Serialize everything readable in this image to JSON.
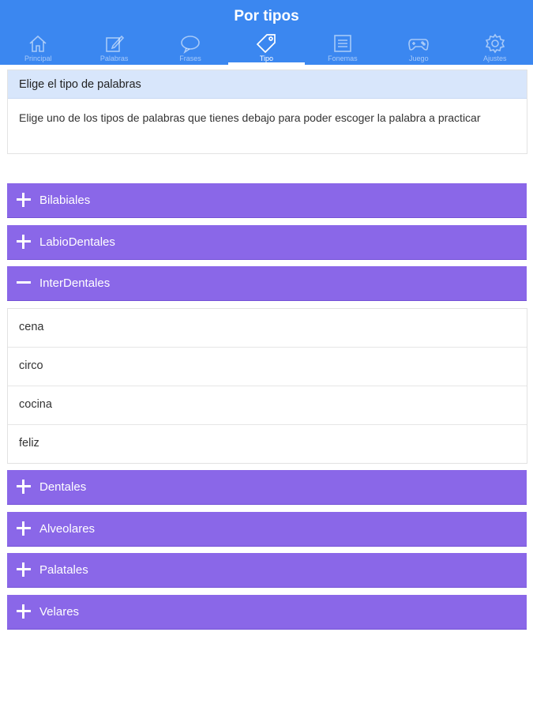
{
  "header": {
    "title": "Por tipos"
  },
  "tabs": [
    {
      "label": "Principal",
      "icon": "home-icon",
      "active": false
    },
    {
      "label": "Palabras",
      "icon": "edit-icon",
      "active": false
    },
    {
      "label": "Frases",
      "icon": "speech-bubble-icon",
      "active": false
    },
    {
      "label": "Tipo",
      "icon": "tag-icon",
      "active": true
    },
    {
      "label": "Fonemas",
      "icon": "list-icon",
      "active": false
    },
    {
      "label": "Juego",
      "icon": "gamepad-icon",
      "active": false
    },
    {
      "label": "Ajustes",
      "icon": "gear-icon",
      "active": false
    }
  ],
  "info": {
    "heading": "Elige el tipo de palabras",
    "body": "Elige uno de los tipos de palabras que tienes debajo para poder escoger la palabra a practicar"
  },
  "groups": [
    {
      "label": "Bilabiales",
      "expanded": false
    },
    {
      "label": "LabioDentales",
      "expanded": false
    },
    {
      "label": "InterDentales",
      "expanded": true
    },
    {
      "label": "Dentales",
      "expanded": false
    },
    {
      "label": "Alveolares",
      "expanded": false
    },
    {
      "label": "Palatales",
      "expanded": false
    },
    {
      "label": "Velares",
      "expanded": false
    }
  ],
  "words": [
    "cena",
    "circo",
    "cocina",
    "feliz"
  ],
  "colors": {
    "header": "#3b87f0",
    "group": "#8a67e8",
    "info_head": "#d8e6fb"
  }
}
